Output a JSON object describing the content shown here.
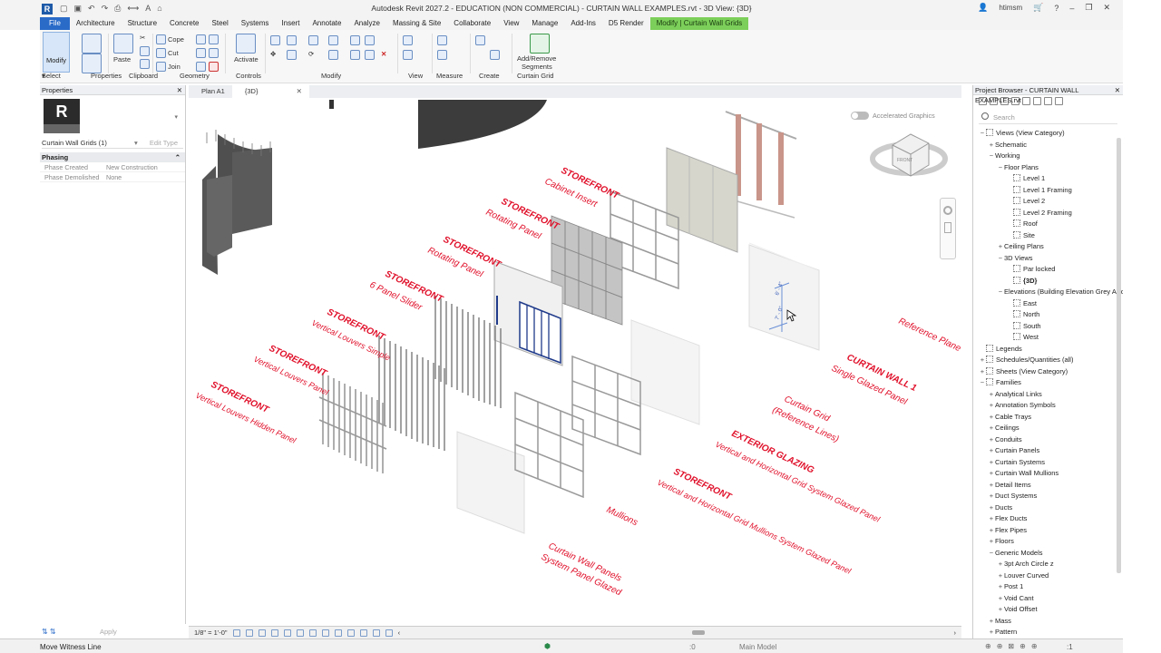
{
  "app": {
    "title": "Autodesk Revit 2027.2 - EDUCATION (NON COMMERCIAL) - CURTAIN WALL EXAMPLES.rvt - 3D View: {3D}",
    "user": "htimsm"
  },
  "ribbon_tabs": [
    "File",
    "Architecture",
    "Structure",
    "Concrete",
    "Steel",
    "Systems",
    "Insert",
    "Annotate",
    "Analyze",
    "Massing & Site",
    "Collaborate",
    "View",
    "Manage",
    "Add-Ins",
    "D5 Render",
    "Modify | Curtain Wall Grids"
  ],
  "ribbon": {
    "modify": "Modify",
    "properties": "Properties",
    "paste": "Paste",
    "cope": "Cope",
    "cut": "Cut",
    "join": "Join",
    "activate": "Activate",
    "add_remove_1": "Add/Remove",
    "add_remove_2": "Segments",
    "select": "Select",
    "panels": [
      "Properties",
      "Clipboard",
      "Geometry",
      "Controls",
      "Modify",
      "View",
      "Measure",
      "Create",
      "Curtain Grid"
    ]
  },
  "properties": {
    "title": "Properties",
    "instance": "Curtain Wall Grids (1)",
    "edit_type": "Edit Type",
    "group": "Phasing",
    "rows": [
      {
        "k": "Phase Created",
        "v": "New Construction"
      },
      {
        "k": "Phase Demolished",
        "v": "None"
      }
    ],
    "apply": "Apply"
  },
  "view_tabs": [
    {
      "label": "Plan A1"
    },
    {
      "label": "{3D}"
    }
  ],
  "viewport": {
    "accelerated": "Accelerated Graphics",
    "labels": [
      {
        "a": "STOREFRONT",
        "b": "Cabinet Insert"
      },
      {
        "a": "STOREFRONT",
        "b": "Rotating Panel"
      },
      {
        "a": "STOREFRONT",
        "b": "Rotating Panel"
      },
      {
        "a": "STOREFRONT",
        "b": "6 Panel Slider"
      },
      {
        "a": "STOREFRONT",
        "b": "Vertical Louvers Simple"
      },
      {
        "a": "STOREFRONT",
        "b": "Vertical Louvers Panel"
      },
      {
        "a": "STOREFRONT",
        "b": "Vertical Louvers Hidden Panel"
      },
      {
        "a": "Reference Plane",
        "b": ""
      },
      {
        "a": "CURTAIN WALL 1",
        "b": "Single Glazed Panel"
      },
      {
        "a": "Curtain Grid",
        "b": "(Reference Lines)"
      },
      {
        "a": "EXTERIOR GLAZING",
        "b": "Vertical and Horizontal Grid System Glazed Panel"
      },
      {
        "a": "STOREFRONT",
        "b": "Vertical and Horizontal Grid Mullions  System Glazed Panel"
      },
      {
        "a": "Mullions",
        "b": ""
      },
      {
        "a": "Curtain Wall Panels",
        "b": "System Panel Glazed"
      }
    ],
    "dim_text": "7' - 0\"  ·  6' - 4\""
  },
  "view_control": {
    "scale": "1/8\" = 1'-0\""
  },
  "project_browser": {
    "title": "Project Browser - CURTAIN WALL EXAMPLES.rvt",
    "search": "Search",
    "nodes": [
      {
        "t": "Views (View Category)",
        "d": 0,
        "tg": "−",
        "vi": true
      },
      {
        "t": "Schematic",
        "d": 1,
        "tg": "+"
      },
      {
        "t": "Working",
        "d": 1,
        "tg": "−"
      },
      {
        "t": "Floor Plans",
        "d": 2,
        "tg": "−"
      },
      {
        "t": "Level 1",
        "d": 3,
        "vi": true
      },
      {
        "t": "Level 1 Framing",
        "d": 3,
        "vi": true
      },
      {
        "t": "Level 2",
        "d": 3,
        "vi": true
      },
      {
        "t": "Level 2 Framing",
        "d": 3,
        "vi": true
      },
      {
        "t": "Roof",
        "d": 3,
        "vi": true
      },
      {
        "t": "Site",
        "d": 3,
        "vi": true
      },
      {
        "t": "Ceiling Plans",
        "d": 2,
        "tg": "+"
      },
      {
        "t": "3D Views",
        "d": 2,
        "tg": "−"
      },
      {
        "t": "Par locked",
        "d": 3,
        "vi": true
      },
      {
        "t": "{3D}",
        "d": 3,
        "vi": true,
        "b": true
      },
      {
        "t": "Elevations (Building Elevation Grey Arrow)",
        "d": 2,
        "tg": "−"
      },
      {
        "t": "East",
        "d": 3,
        "vi": true
      },
      {
        "t": "North",
        "d": 3,
        "vi": true
      },
      {
        "t": "South",
        "d": 3,
        "vi": true
      },
      {
        "t": "West",
        "d": 3,
        "vi": true
      },
      {
        "t": "Legends",
        "d": 0,
        "vi": true
      },
      {
        "t": "Schedules/Quantities (all)",
        "d": 0,
        "tg": "+",
        "vi": true
      },
      {
        "t": "Sheets (View Category)",
        "d": 0,
        "tg": "+",
        "vi": true
      },
      {
        "t": "Families",
        "d": 0,
        "tg": "−",
        "vi": true
      },
      {
        "t": "Analytical Links",
        "d": 1,
        "tg": "+"
      },
      {
        "t": "Annotation Symbols",
        "d": 1,
        "tg": "+"
      },
      {
        "t": "Cable Trays",
        "d": 1,
        "tg": "+"
      },
      {
        "t": "Ceilings",
        "d": 1,
        "tg": "+"
      },
      {
        "t": "Conduits",
        "d": 1,
        "tg": "+"
      },
      {
        "t": "Curtain Panels",
        "d": 1,
        "tg": "+"
      },
      {
        "t": "Curtain Systems",
        "d": 1,
        "tg": "+"
      },
      {
        "t": "Curtain Wall Mullions",
        "d": 1,
        "tg": "+"
      },
      {
        "t": "Detail Items",
        "d": 1,
        "tg": "+"
      },
      {
        "t": "Duct Systems",
        "d": 1,
        "tg": "+"
      },
      {
        "t": "Ducts",
        "d": 1,
        "tg": "+"
      },
      {
        "t": "Flex Ducts",
        "d": 1,
        "tg": "+"
      },
      {
        "t": "Flex Pipes",
        "d": 1,
        "tg": "+"
      },
      {
        "t": "Floors",
        "d": 1,
        "tg": "+"
      },
      {
        "t": "Generic Models",
        "d": 1,
        "tg": "−"
      },
      {
        "t": "3pt Arch Circle z",
        "d": 2,
        "tg": "+"
      },
      {
        "t": "Louver Curved",
        "d": 2,
        "tg": "+"
      },
      {
        "t": "Post 1",
        "d": 2,
        "tg": "+"
      },
      {
        "t": "Void Cant",
        "d": 2,
        "tg": "+"
      },
      {
        "t": "Void Offset",
        "d": 2,
        "tg": "+"
      },
      {
        "t": "Mass",
        "d": 1,
        "tg": "+"
      },
      {
        "t": "Pattern",
        "d": 1,
        "tg": "+"
      }
    ]
  },
  "status": {
    "message": "Move Witness Line",
    "zero": ":0",
    "model": "Main Model",
    "filter": ":1"
  },
  "colors": {
    "accent": "#2a6bc8",
    "context_tab": "#7ccf5a",
    "annotation_red": "#e0102a"
  }
}
